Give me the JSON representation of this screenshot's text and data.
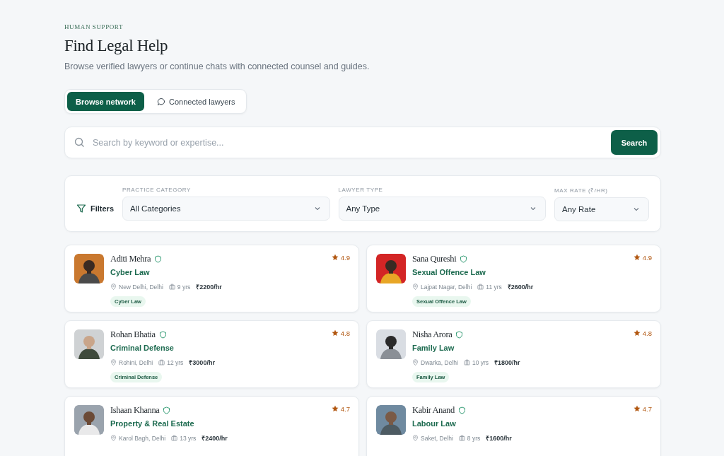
{
  "header": {
    "eyebrow": "HUMAN SUPPORT",
    "title": "Find Legal Help",
    "subtitle": "Browse verified lawyers or continue chats with connected counsel and guides."
  },
  "tabs": [
    {
      "label": "Browse network",
      "selected": true,
      "kind": "plain"
    },
    {
      "label": "Connected lawyers",
      "selected": false,
      "kind": "chat"
    }
  ],
  "search": {
    "placeholder": "Search by keyword or expertise...",
    "button": "Search"
  },
  "filters": {
    "label": "Filters",
    "fields": [
      {
        "label": "PRACTICE CATEGORY",
        "value": "All Categories"
      },
      {
        "label": "LAWYER TYPE",
        "value": "Any Type"
      },
      {
        "label": "MAX RATE (₹/HR)",
        "value": "Any Rate"
      }
    ]
  },
  "lawyers": [
    {
      "name": "Aditi Mehra",
      "specialty": "Cyber Law",
      "location": "New Delhi, Delhi",
      "experience": "9 yrs",
      "rate": "₹2200/hr",
      "rating": "4.9",
      "tag": "Cyber Law"
    },
    {
      "name": "Sana Qureshi",
      "specialty": "Sexual Offence Law",
      "location": "Lajpat Nagar, Delhi",
      "experience": "11 yrs",
      "rate": "₹2600/hr",
      "rating": "4.9",
      "tag": "Sexual Offence Law"
    },
    {
      "name": "Rohan Bhatia",
      "specialty": "Criminal Defense",
      "location": "Rohini, Delhi",
      "experience": "12 yrs",
      "rate": "₹3000/hr",
      "rating": "4.8",
      "tag": "Criminal Defense"
    },
    {
      "name": "Nisha Arora",
      "specialty": "Family Law",
      "location": "Dwarka, Delhi",
      "experience": "10 yrs",
      "rate": "₹1800/hr",
      "rating": "4.8",
      "tag": "Family Law"
    },
    {
      "name": "Ishaan Khanna",
      "specialty": "Property & Real Estate",
      "location": "Karol Bagh, Delhi",
      "experience": "13 yrs",
      "rate": "₹2400/hr",
      "rating": "4.7"
    },
    {
      "name": "Kabir Anand",
      "specialty": "Labour Law",
      "location": "Saket, Delhi",
      "experience": "8 yrs",
      "rate": "₹1600/hr",
      "rating": "4.7"
    }
  ]
}
